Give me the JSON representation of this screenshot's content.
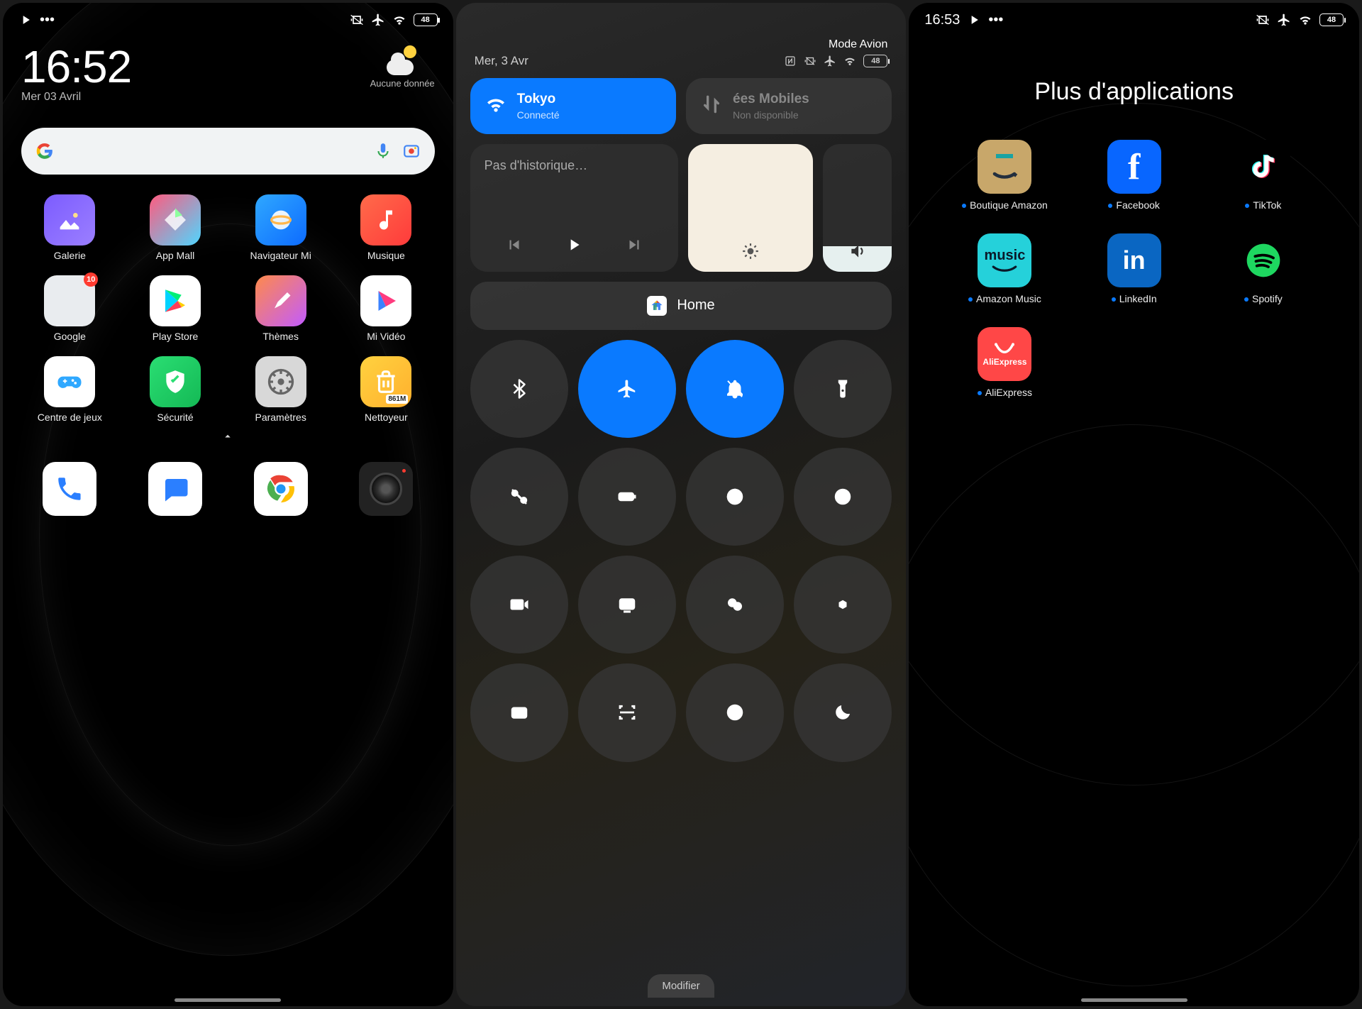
{
  "home": {
    "status": {
      "battery": "48"
    },
    "clock": {
      "time": "16:52",
      "date": "Mer 03 Avril"
    },
    "weather": {
      "label": "Aucune donnée"
    },
    "apps": [
      {
        "id": "galerie",
        "label": "Galerie"
      },
      {
        "id": "appmall",
        "label": "App Mall"
      },
      {
        "id": "navigateur",
        "label": "Navigateur Mi"
      },
      {
        "id": "musique",
        "label": "Musique"
      },
      {
        "id": "google",
        "label": "Google",
        "badge": "10"
      },
      {
        "id": "playstore",
        "label": "Play Store"
      },
      {
        "id": "themes",
        "label": "Thèmes"
      },
      {
        "id": "mivideo",
        "label": "Mi Vidéo"
      },
      {
        "id": "jeux",
        "label": "Centre de jeux"
      },
      {
        "id": "securite",
        "label": "Sécurité"
      },
      {
        "id": "parametres",
        "label": "Paramètres"
      },
      {
        "id": "nettoyeur",
        "label": "Nettoyeur",
        "mini": "861M"
      }
    ]
  },
  "cc": {
    "mode": "Mode Avion",
    "date": "Mer, 3 Avr",
    "battery": "48",
    "wifi": {
      "name": "Tokyo",
      "status": "Connecté"
    },
    "data": {
      "name": "ées Mobiles",
      "status": "Non disponible"
    },
    "media": {
      "text": "Pas d'historique…"
    },
    "home": "Home",
    "modifier": "Modifier"
  },
  "folder": {
    "status": {
      "time": "16:53",
      "battery": "48"
    },
    "title": "Plus d'applications",
    "apps": [
      {
        "id": "amazon",
        "label": "Boutique Amazon"
      },
      {
        "id": "facebook",
        "label": "Facebook"
      },
      {
        "id": "tiktok",
        "label": "TikTok"
      },
      {
        "id": "amazonmusic",
        "label": "Amazon Music"
      },
      {
        "id": "linkedin",
        "label": "LinkedIn"
      },
      {
        "id": "spotify",
        "label": "Spotify"
      },
      {
        "id": "aliexpress",
        "label": "AliExpress"
      }
    ]
  }
}
